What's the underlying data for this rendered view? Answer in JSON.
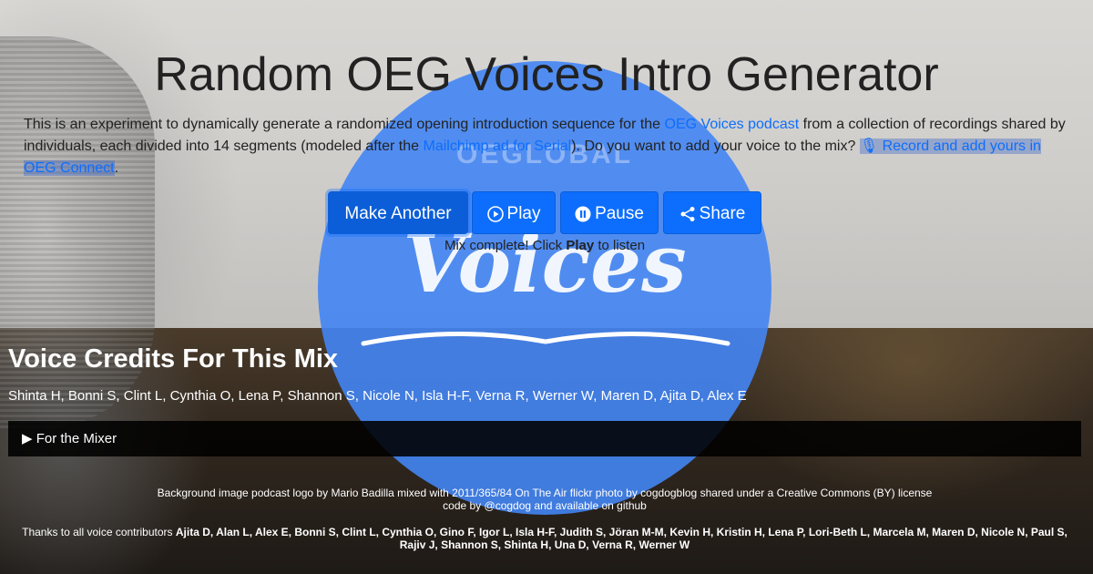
{
  "page": {
    "title": "Random OEG Voices Intro Generator"
  },
  "intro": {
    "text_1": "This is an experiment to dynamically generate a randomized opening introduction sequence for the ",
    "link_podcast": "OEG Voices podcast",
    "text_2": " from a collection of recordings shared by individuals, each divided into 14 segments (modeled after the ",
    "link_mailchimp": "Mailchimp ad for Serial",
    "text_3": "). Do you want to add your voice to the mix? ",
    "link_record": "Record and add yours in OEG Connect",
    "text_4": "."
  },
  "logo": {
    "top_text": "OEGLOBAL",
    "main_text": "Voices"
  },
  "buttons": {
    "make_another": "Make Another",
    "play": "Play",
    "pause": "Pause",
    "share": "Share"
  },
  "status": {
    "prefix": "Mix complete! Click ",
    "bold": "Play",
    "suffix": " to listen"
  },
  "credits": {
    "heading": "Voice Credits For This Mix",
    "names": "Shinta H, Bonni S, Clint L, Cynthia O, Lena P, Shannon S, Nicole N, Isla H-F, Verna R, Werner W, Maren D, Ajita D, Alex E"
  },
  "mixer": {
    "label": "For the Mixer"
  },
  "footer": {
    "line1": "Background image podcast logo by Mario Badilla mixed with 2011/365/84 On The Air flickr photo by cogdogblog shared under a Creative Commons (BY) license",
    "line2": "code by @cogdog and available on github",
    "thanks_prefix": "Thanks to all voice contributors ",
    "thanks_names": "Ajita D, Alan L, Alex E, Bonni S, Clint L, Cynthia O, Gino F, Igor L, Isla H-F, Judith S, Jöran M-M, Kevin H, Kristin H, Lena P, Lori-Beth L, Marcela M, Maren D, Nicole N, Paul S, Rajiv J, Shannon S, Shinta H, Una D, Verna R, Werner W"
  },
  "colors": {
    "accent": "#0d6efd",
    "logo_circle": "#4285f4"
  },
  "icons": {
    "record": "microphone-icon",
    "play": "play-circle-icon",
    "pause": "pause-circle-icon",
    "share": "share-icon",
    "mixer": "triangle-right-icon"
  }
}
